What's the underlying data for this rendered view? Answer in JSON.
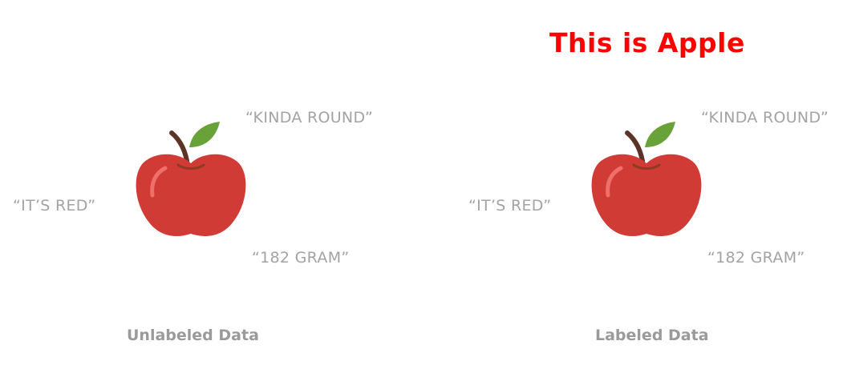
{
  "label_title": "This is Apple",
  "unlabeled": {
    "attr_round": "“KINDA ROUND”",
    "attr_red": "“IT’S RED”",
    "attr_gram": "“182 GRAM”",
    "caption": "Unlabeled Data"
  },
  "labeled": {
    "attr_round": "“KINDA ROUND”",
    "attr_red": "“IT’S RED”",
    "attr_gram": "“182 GRAM”",
    "caption": "Labeled Data"
  },
  "colors": {
    "apple_body": "#d13b36",
    "apple_highlight": "#ef6f6a",
    "stem": "#5b3427",
    "leaf": "#6aa23a",
    "attribute_text": "#a3a3a3",
    "caption_text": "#9a9a9a",
    "label_title": "#ff0000"
  },
  "icons": [
    "apple-icon",
    "leaf-icon",
    "stem-icon"
  ]
}
